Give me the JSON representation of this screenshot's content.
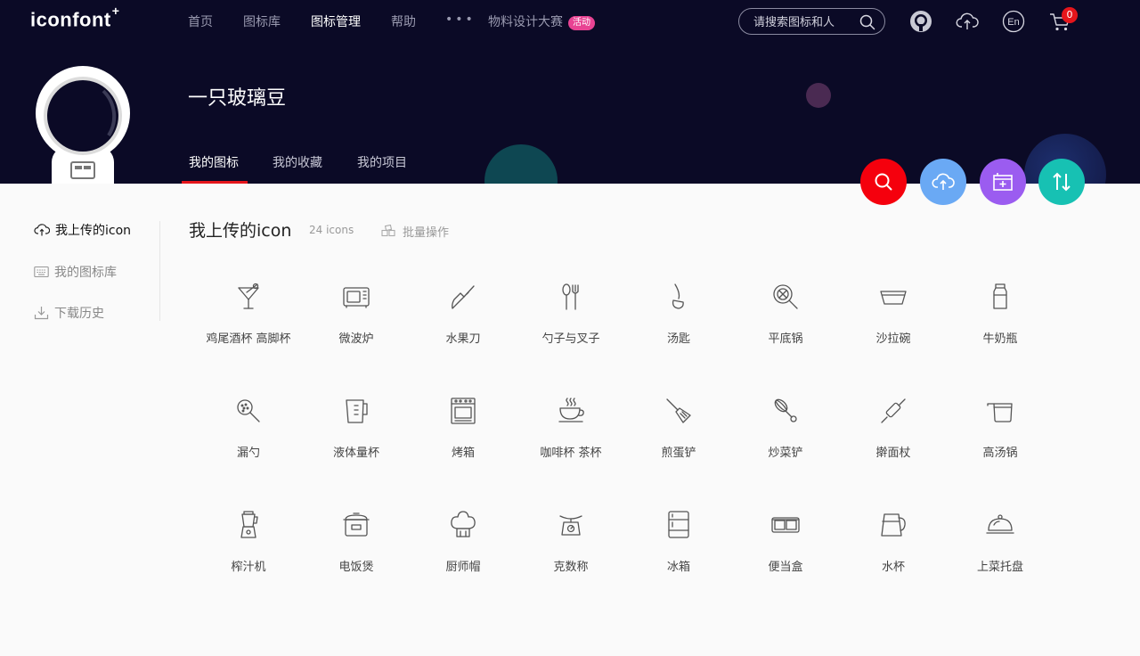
{
  "brand": {
    "logo": "iconfont",
    "logo_mark": "+"
  },
  "nav": {
    "items": [
      "首页",
      "图标库",
      "图标管理",
      "帮助"
    ],
    "more": "•••",
    "event_label": "物料设计大赛",
    "event_badge": "活动"
  },
  "search": {
    "placeholder": "请搜索图标和人"
  },
  "header_icons": [
    "github-icon",
    "upload-cloud-icon",
    "language-icon",
    "cart-icon"
  ],
  "language_label": "En",
  "cart": {
    "count": "0"
  },
  "profile": {
    "name": "一只玻璃豆"
  },
  "tabs": [
    "我的图标",
    "我的收藏",
    "我的项目"
  ],
  "fab_buttons": [
    {
      "icon": "search-icon",
      "color": "#f5000d"
    },
    {
      "icon": "upload-cloud-icon",
      "color": "#6aa9f4"
    },
    {
      "icon": "add-project-icon",
      "color": "#9b5cf0"
    },
    {
      "icon": "sort-icon",
      "color": "#17c1b3"
    }
  ],
  "sidebar": {
    "items": [
      {
        "label": "我上传的icon",
        "icon": "upload-cloud-icon"
      },
      {
        "label": "我的图标库",
        "icon": "keyboard-icon"
      },
      {
        "label": "下载历史",
        "icon": "download-icon"
      }
    ]
  },
  "main": {
    "title": "我上传的icon",
    "count": "24 icons",
    "batch_label": "批量操作"
  },
  "icons": [
    {
      "label": "鸡尾酒杯 高脚杯",
      "icon": "cocktail-glass-icon"
    },
    {
      "label": "微波炉",
      "icon": "microwave-icon"
    },
    {
      "label": "水果刀",
      "icon": "fruit-knife-icon"
    },
    {
      "label": "勺子与叉子",
      "icon": "spoon-fork-icon"
    },
    {
      "label": "汤匙",
      "icon": "ladle-icon"
    },
    {
      "label": "平底锅",
      "icon": "frying-pan-icon"
    },
    {
      "label": "沙拉碗",
      "icon": "salad-bowl-icon"
    },
    {
      "label": "牛奶瓶",
      "icon": "milk-bottle-icon"
    },
    {
      "label": "漏勺",
      "icon": "skimmer-icon"
    },
    {
      "label": "液体量杯",
      "icon": "measuring-cup-icon"
    },
    {
      "label": "烤箱",
      "icon": "oven-icon"
    },
    {
      "label": "咖啡杯 茶杯",
      "icon": "coffee-cup-icon"
    },
    {
      "label": "煎蛋铲",
      "icon": "spatula-icon"
    },
    {
      "label": "炒菜铲",
      "icon": "whisk-icon"
    },
    {
      "label": "擀面杖",
      "icon": "rolling-pin-icon"
    },
    {
      "label": "高汤锅",
      "icon": "stock-pot-icon"
    },
    {
      "label": "榨汁机",
      "icon": "juicer-icon"
    },
    {
      "label": "电饭煲",
      "icon": "rice-cooker-icon"
    },
    {
      "label": "厨师帽",
      "icon": "chef-hat-icon"
    },
    {
      "label": "克数称",
      "icon": "kitchen-scale-icon"
    },
    {
      "label": "冰箱",
      "icon": "fridge-icon"
    },
    {
      "label": "便当盒",
      "icon": "lunch-box-icon"
    },
    {
      "label": "水杯",
      "icon": "kettle-icon"
    },
    {
      "label": "上菜托盘",
      "icon": "serving-tray-icon"
    }
  ]
}
